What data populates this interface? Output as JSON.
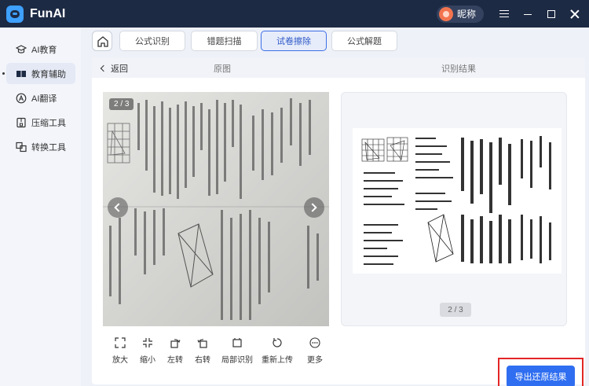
{
  "app": {
    "name": "FunAI"
  },
  "user": {
    "nickname": "昵称"
  },
  "sidebar": {
    "items": [
      {
        "label": "AI教育",
        "icon": "graduation-cap-icon"
      },
      {
        "label": "教育辅助",
        "icon": "book-icon",
        "active": true
      },
      {
        "label": "AI翻译",
        "icon": "translate-icon"
      },
      {
        "label": "压缩工具",
        "icon": "compress-icon"
      },
      {
        "label": "转换工具",
        "icon": "convert-icon"
      }
    ]
  },
  "tabs": [
    {
      "label": "公式识别"
    },
    {
      "label": "错题扫描"
    },
    {
      "label": "试卷擦除",
      "active": true
    },
    {
      "label": "公式解题"
    }
  ],
  "header": {
    "back": "返回",
    "original": "原图",
    "result": "识别结果"
  },
  "original": {
    "page_indicator": "2 / 3"
  },
  "result": {
    "page_indicator": "2 / 3"
  },
  "toolbar": [
    {
      "label": "放大",
      "icon": "zoom-in-icon"
    },
    {
      "label": "缩小",
      "icon": "zoom-out-icon"
    },
    {
      "label": "左转",
      "icon": "rotate-left-icon"
    },
    {
      "label": "右转",
      "icon": "rotate-right-icon"
    },
    {
      "label": "局部识别",
      "icon": "crop-icon"
    },
    {
      "label": "重新上传",
      "icon": "reupload-icon"
    },
    {
      "label": "更多",
      "icon": "more-icon"
    }
  ],
  "export": {
    "label": "导出还原结果"
  },
  "colors": {
    "titlebar": "#1d2a44",
    "accent": "#2f6ef0",
    "highlight": "#e32626",
    "sidebar": "#f3f5fa"
  }
}
